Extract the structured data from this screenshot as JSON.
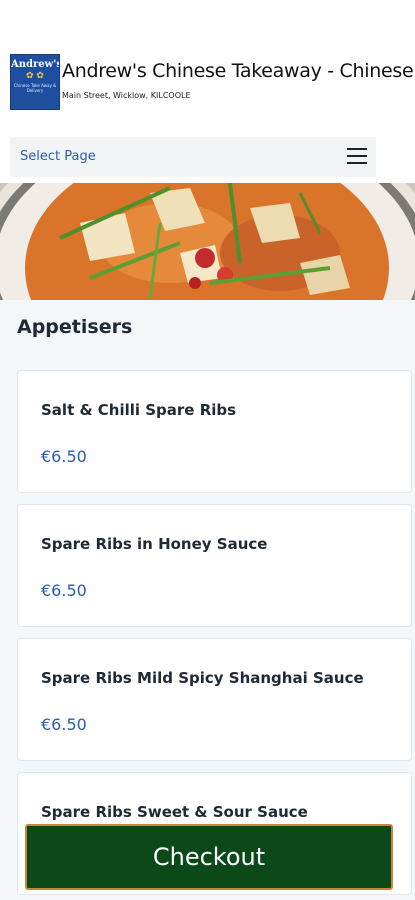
{
  "header": {
    "logo": {
      "name": "Andrew's",
      "subtext": "Chinese Take Away & Delivery"
    },
    "title": "Andrew's Chinese Takeaway - Chinese",
    "address": "Main Street, Wicklow, KILCOOLE"
  },
  "nav": {
    "select_label": "Select Page",
    "menu_icon": "hamburger-icon"
  },
  "hero": {
    "image": "curry-dish-photo"
  },
  "menu": {
    "section_title": "Appetisers",
    "items": [
      {
        "name": "Salt & Chilli Spare Ribs",
        "price": "€6.50"
      },
      {
        "name": "Spare Ribs in Honey Sauce",
        "price": "€6.50"
      },
      {
        "name": "Spare Ribs Mild Spicy Shanghai Sauce",
        "price": "€6.50"
      },
      {
        "name": "Spare Ribs Sweet & Sour Sauce",
        "price": ""
      }
    ]
  },
  "checkout": {
    "label": "Checkout"
  },
  "colors": {
    "accent_blue": "#2a5db0",
    "checkout_green": "#0b4a18",
    "checkout_border": "#c9843a"
  }
}
